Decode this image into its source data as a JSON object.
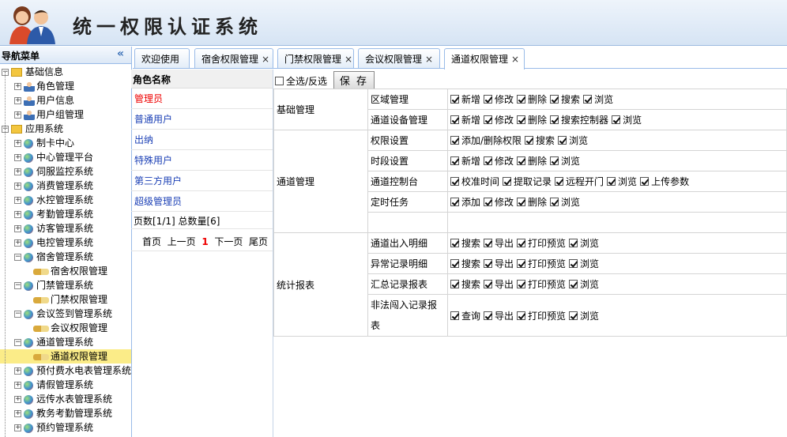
{
  "app": {
    "title": "统一权限认证系统"
  },
  "sidebar": {
    "title": "导航菜单",
    "tree": [
      {
        "label": "基础信息",
        "level": 0,
        "icon": "folder-icon"
      },
      {
        "label": "角色管理",
        "level": 1,
        "icon": "user-icon"
      },
      {
        "label": "用户信息",
        "level": 1,
        "icon": "user-icon"
      },
      {
        "label": "用户组管理",
        "level": 1,
        "icon": "user-icon"
      },
      {
        "label": "应用系统",
        "level": 0,
        "icon": "home-icon"
      },
      {
        "label": "制卡中心",
        "level": 1,
        "icon": "globe-icon"
      },
      {
        "label": "中心管理平台",
        "level": 1,
        "icon": "globe-icon"
      },
      {
        "label": "伺服监控系统",
        "level": 1,
        "icon": "globe-icon"
      },
      {
        "label": "消费管理系统",
        "level": 1,
        "icon": "globe-icon"
      },
      {
        "label": "水控管理系统",
        "level": 1,
        "icon": "globe-icon"
      },
      {
        "label": "考勤管理系统",
        "level": 1,
        "icon": "globe-icon"
      },
      {
        "label": "访客管理系统",
        "level": 1,
        "icon": "globe-icon"
      },
      {
        "label": "电控管理系统",
        "level": 1,
        "icon": "globe-icon"
      },
      {
        "label": "宿舍管理系统",
        "level": 1,
        "icon": "globe-icon"
      },
      {
        "label": "宿舍权限管理",
        "level": 2,
        "icon": "key-icon"
      },
      {
        "label": "门禁管理系统",
        "level": 1,
        "icon": "globe-icon"
      },
      {
        "label": "门禁权限管理",
        "level": 2,
        "icon": "key-icon"
      },
      {
        "label": "会议签到管理系统",
        "level": 1,
        "icon": "globe-icon"
      },
      {
        "label": "会议权限管理",
        "level": 2,
        "icon": "key-icon"
      },
      {
        "label": "通道管理系统",
        "level": 1,
        "icon": "globe-icon"
      },
      {
        "label": "通道权限管理",
        "level": 2,
        "icon": "key-icon",
        "selected": true
      },
      {
        "label": "预付费水电表管理系统",
        "level": 1,
        "icon": "globe-icon"
      },
      {
        "label": "请假管理系统",
        "level": 1,
        "icon": "globe-icon"
      },
      {
        "label": "远传水表管理系统",
        "level": 1,
        "icon": "globe-icon"
      },
      {
        "label": "教务考勤管理系统",
        "level": 1,
        "icon": "globe-icon"
      },
      {
        "label": "预约管理系统",
        "level": 1,
        "icon": "globe-icon"
      }
    ]
  },
  "tabs": [
    {
      "label": "欢迎使用",
      "closable": false
    },
    {
      "label": "宿舍权限管理",
      "closable": true
    },
    {
      "label": "门禁权限管理",
      "closable": true
    },
    {
      "label": "会议权限管理",
      "closable": true
    },
    {
      "label": "通道权限管理",
      "closable": true,
      "active": true
    }
  ],
  "roles": {
    "header": "角色名称",
    "items": [
      "管理员",
      "普通用户",
      "出纳",
      "特殊用户",
      "第三方用户",
      "超级管理员"
    ],
    "pager_info": "页数[1/1]  总数量[6]",
    "pager": {
      "first": "首页",
      "prev": "上一页",
      "current": "1",
      "next": "下一页",
      "last": "尾页"
    }
  },
  "toolbar": {
    "select_all_label": "全选/反选",
    "save_label": "保 存"
  },
  "permissions": [
    {
      "category": "基础管理",
      "modules": [
        {
          "name": "区域管理",
          "items": [
            "新增",
            "修改",
            "删除",
            "搜索",
            "浏览"
          ]
        },
        {
          "name": "通道设备管理",
          "items": [
            "新增",
            "修改",
            "删除",
            "搜索控制器",
            "浏览"
          ]
        }
      ]
    },
    {
      "category": "通道管理",
      "modules": [
        {
          "name": "权限设置",
          "items": [
            "添加/删除权限",
            "搜索",
            "浏览"
          ]
        },
        {
          "name": "时段设置",
          "items": [
            "新增",
            "修改",
            "删除",
            "浏览"
          ]
        },
        {
          "name": "通道控制台",
          "items": [
            "校准时间",
            "提取记录",
            "远程开门",
            "浏览",
            "上传参数"
          ]
        },
        {
          "name": "定时任务",
          "items": [
            "添加",
            "修改",
            "删除",
            "浏览"
          ]
        },
        {
          "name": "",
          "items": []
        }
      ]
    },
    {
      "category": "统计报表",
      "modules": [
        {
          "name": "通道出入明细",
          "items": [
            "搜索",
            "导出",
            "打印预览",
            "浏览"
          ]
        },
        {
          "name": "异常记录明细",
          "items": [
            "搜索",
            "导出",
            "打印预览",
            "浏览"
          ]
        },
        {
          "name": "汇总记录报表",
          "items": [
            "搜索",
            "导出",
            "打印预览",
            "浏览"
          ]
        },
        {
          "name": "非法闯入记录报表",
          "items": [
            "查询",
            "导出",
            "打印预览",
            "浏览"
          ]
        }
      ]
    }
  ]
}
